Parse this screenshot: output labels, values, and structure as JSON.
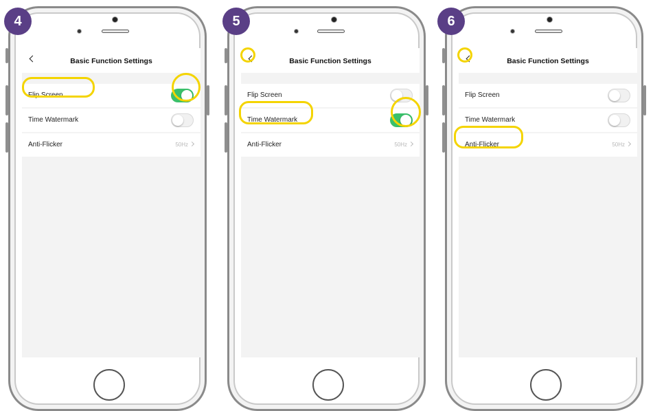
{
  "panels": [
    {
      "step": "4",
      "title": "Basic Function Settings",
      "settings": [
        {
          "label": "Flip Screen",
          "toggle": "on"
        },
        {
          "label": "Time Watermark",
          "toggle": "off"
        },
        {
          "label": "Anti-Flicker",
          "value": "50Hz"
        }
      ],
      "highlighted": [
        "Flip Screen row label",
        "Flip Screen toggle"
      ]
    },
    {
      "step": "5",
      "title": "Basic Function Settings",
      "settings": [
        {
          "label": "Flip Screen",
          "toggle": "off"
        },
        {
          "label": "Time Watermark",
          "toggle": "on"
        },
        {
          "label": "Anti-Flicker",
          "value": "50Hz"
        }
      ],
      "highlighted": [
        "back button",
        "Time Watermark row label",
        "Time Watermark toggle"
      ]
    },
    {
      "step": "6",
      "title": "Basic Function Settings",
      "settings": [
        {
          "label": "Flip Screen",
          "toggle": "off"
        },
        {
          "label": "Time Watermark",
          "toggle": "off"
        },
        {
          "label": "Anti-Flicker",
          "value": "50Hz"
        }
      ],
      "highlighted": [
        "back button",
        "Anti-Flicker row label"
      ]
    }
  ],
  "colors": {
    "step_badge": "#5a3f86",
    "highlight": "#f4d400",
    "toggle_on": "#3ac06a",
    "toggle_off": "#f1f1f1"
  }
}
